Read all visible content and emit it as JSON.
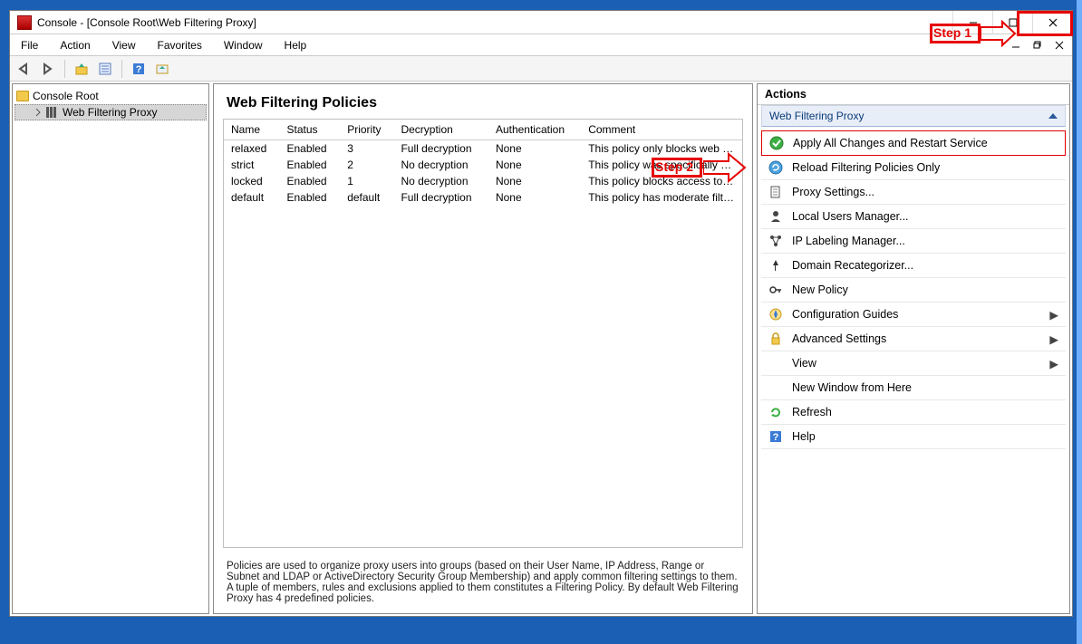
{
  "title": "Console - [Console Root\\Web Filtering Proxy]",
  "annotations": {
    "step1_label": "Step 1",
    "step2_label": "Step 2"
  },
  "menubar": {
    "file": "File",
    "action": "Action",
    "view": "View",
    "favorites": "Favorites",
    "window": "Window",
    "help": "Help"
  },
  "tree": {
    "root_label": "Console Root",
    "child_label": "Web Filtering Proxy"
  },
  "center": {
    "title": "Web Filtering Policies",
    "columns": {
      "name": "Name",
      "status": "Status",
      "priority": "Priority",
      "decryption": "Decryption",
      "authentication": "Authentication",
      "comment": "Comment"
    },
    "rows": [
      {
        "name": "relaxed",
        "status": "Enabled",
        "priority": "3",
        "decryption": "Full decryption",
        "authentication": "None",
        "comment": "This policy only blocks web a..."
      },
      {
        "name": "strict",
        "status": "Enabled",
        "priority": "2",
        "decryption": "No decryption",
        "authentication": "None",
        "comment": "This policy was specifically d..."
      },
      {
        "name": "locked",
        "status": "Enabled",
        "priority": "1",
        "decryption": "No decryption",
        "authentication": "None",
        "comment": "This policy blocks access to a..."
      },
      {
        "name": "default",
        "status": "Enabled",
        "priority": "default",
        "decryption": "Full decryption",
        "authentication": "None",
        "comment": "This policy has moderate filte..."
      }
    ],
    "footer": "Policies are used to organize proxy users into groups (based on their User Name, IP Address, Range or Subnet and LDAP or ActiveDirectory Security Group Membership) and apply common filtering settings to them. A tuple of members, rules and exclusions applied to them constitutes a Filtering Policy. By default Web Filtering Proxy has 4 predefined policies."
  },
  "actions": {
    "header": "Actions",
    "group": "Web Filtering Proxy",
    "items": {
      "apply": "Apply All Changes and Restart Service",
      "reload": "Reload Filtering Policies Only",
      "proxy": "Proxy Settings...",
      "users": "Local Users Manager...",
      "labeling": "IP Labeling Manager...",
      "domain": "Domain Recategorizer...",
      "newpolicy": "New Policy",
      "guides": "Configuration Guides",
      "advanced": "Advanced Settings",
      "view": "View",
      "newwin": "New Window from Here",
      "refresh": "Refresh",
      "help": "Help"
    }
  }
}
